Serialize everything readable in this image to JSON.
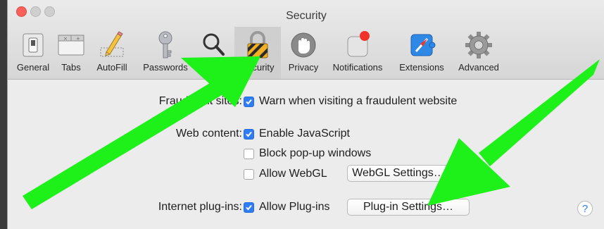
{
  "window": {
    "title": "Security"
  },
  "toolbar": {
    "items": [
      {
        "label": "General",
        "icon": "general-switch-icon"
      },
      {
        "label": "Tabs",
        "icon": "tabs-icon"
      },
      {
        "label": "AutoFill",
        "icon": "autofill-pencil-icon"
      },
      {
        "label": "Passwords",
        "icon": "key-icon"
      },
      {
        "label": "Search",
        "icon": "magnifier-icon"
      },
      {
        "label": "Security",
        "icon": "padlock-icon",
        "selected": true
      },
      {
        "label": "Privacy",
        "icon": "hand-icon"
      },
      {
        "label": "Notifications",
        "icon": "notification-badge-icon"
      },
      {
        "label": "Extensions",
        "icon": "puzzle-compass-icon"
      },
      {
        "label": "Advanced",
        "icon": "gear-icon"
      }
    ]
  },
  "security": {
    "fraud_label": "Fraudulent sites:",
    "fraud_warn": {
      "label": "Warn when visiting a fraudulent website",
      "checked": true
    },
    "web_content_label": "Web content:",
    "enable_js": {
      "label": "Enable JavaScript",
      "checked": true
    },
    "block_popups": {
      "label": "Block pop-up windows",
      "checked": false
    },
    "allow_webgl": {
      "label": "Allow WebGL",
      "checked": false
    },
    "webgl_settings_button": "WebGL Settings…",
    "plugins_label": "Internet plug-ins:",
    "allow_plugins": {
      "label": "Allow Plug-ins",
      "checked": true
    },
    "plugin_settings_button": "Plug-in Settings…",
    "help_button": "?"
  },
  "annotations": {
    "arrow_color": "#1ef01a"
  },
  "colors": {
    "checkbox_accent": "#2f7cf6",
    "close_button": "#fc605b"
  }
}
